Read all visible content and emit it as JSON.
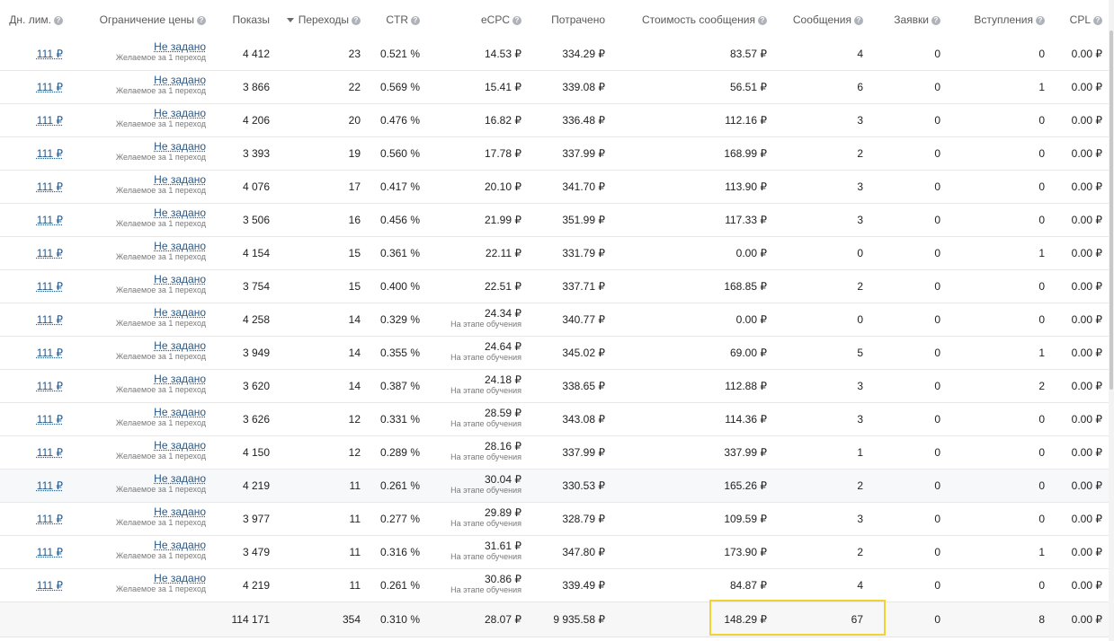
{
  "headers": {
    "daily_limit": "Дн. лим.",
    "price_limit": "Ограничение цены",
    "impressions": "Показы",
    "clicks": "Переходы",
    "ctr": "CTR",
    "ecpc": "eCPC",
    "spent": "Потрачено",
    "msg_cost": "Стоимость сообщения",
    "messages": "Сообщения",
    "applications": "Заявки",
    "joins": "Вступления",
    "cpl": "CPL"
  },
  "rows": [
    {
      "limit": "111 ₽",
      "price": "Не задано",
      "price_sub": "Желаемое за 1 переход",
      "impressions": "4 412",
      "clicks": "23",
      "ctr": "0.521 %",
      "ecpc": "14.53 ₽",
      "ecpc_sub": "",
      "spent": "334.29 ₽",
      "msg_cost": "83.57 ₽",
      "messages": "4",
      "applications": "0",
      "joins": "0",
      "cpl": "0.00 ₽"
    },
    {
      "limit": "111 ₽",
      "price": "Не задано",
      "price_sub": "Желаемое за 1 переход",
      "impressions": "3 866",
      "clicks": "22",
      "ctr": "0.569 %",
      "ecpc": "15.41 ₽",
      "ecpc_sub": "",
      "spent": "339.08 ₽",
      "msg_cost": "56.51 ₽",
      "messages": "6",
      "applications": "0",
      "joins": "1",
      "cpl": "0.00 ₽"
    },
    {
      "limit": "111 ₽",
      "price": "Не задано",
      "price_sub": "Желаемое за 1 переход",
      "impressions": "4 206",
      "clicks": "20",
      "ctr": "0.476 %",
      "ecpc": "16.82 ₽",
      "ecpc_sub": "",
      "spent": "336.48 ₽",
      "msg_cost": "112.16 ₽",
      "messages": "3",
      "applications": "0",
      "joins": "0",
      "cpl": "0.00 ₽"
    },
    {
      "limit": "111 ₽",
      "price": "Не задано",
      "price_sub": "Желаемое за 1 переход",
      "impressions": "3 393",
      "clicks": "19",
      "ctr": "0.560 %",
      "ecpc": "17.78 ₽",
      "ecpc_sub": "",
      "spent": "337.99 ₽",
      "msg_cost": "168.99 ₽",
      "messages": "2",
      "applications": "0",
      "joins": "0",
      "cpl": "0.00 ₽"
    },
    {
      "limit": "111 ₽",
      "price": "Не задано",
      "price_sub": "Желаемое за 1 переход",
      "impressions": "4 076",
      "clicks": "17",
      "ctr": "0.417 %",
      "ecpc": "20.10 ₽",
      "ecpc_sub": "",
      "spent": "341.70 ₽",
      "msg_cost": "113.90 ₽",
      "messages": "3",
      "applications": "0",
      "joins": "0",
      "cpl": "0.00 ₽"
    },
    {
      "limit": "111 ₽",
      "price": "Не задано",
      "price_sub": "Желаемое за 1 переход",
      "impressions": "3 506",
      "clicks": "16",
      "ctr": "0.456 %",
      "ecpc": "21.99 ₽",
      "ecpc_sub": "",
      "spent": "351.99 ₽",
      "msg_cost": "117.33 ₽",
      "messages": "3",
      "applications": "0",
      "joins": "0",
      "cpl": "0.00 ₽"
    },
    {
      "limit": "111 ₽",
      "price": "Не задано",
      "price_sub": "Желаемое за 1 переход",
      "impressions": "4 154",
      "clicks": "15",
      "ctr": "0.361 %",
      "ecpc": "22.11 ₽",
      "ecpc_sub": "",
      "spent": "331.79 ₽",
      "msg_cost": "0.00 ₽",
      "messages": "0",
      "applications": "0",
      "joins": "1",
      "cpl": "0.00 ₽"
    },
    {
      "limit": "111 ₽",
      "price": "Не задано",
      "price_sub": "Желаемое за 1 переход",
      "impressions": "3 754",
      "clicks": "15",
      "ctr": "0.400 %",
      "ecpc": "22.51 ₽",
      "ecpc_sub": "",
      "spent": "337.71 ₽",
      "msg_cost": "168.85 ₽",
      "messages": "2",
      "applications": "0",
      "joins": "0",
      "cpl": "0.00 ₽"
    },
    {
      "limit": "111 ₽",
      "price": "Не задано",
      "price_sub": "Желаемое за 1 переход",
      "impressions": "4 258",
      "clicks": "14",
      "ctr": "0.329 %",
      "ecpc": "24.34 ₽",
      "ecpc_sub": "На этапе обучения",
      "spent": "340.77 ₽",
      "msg_cost": "0.00 ₽",
      "messages": "0",
      "applications": "0",
      "joins": "0",
      "cpl": "0.00 ₽"
    },
    {
      "limit": "111 ₽",
      "price": "Не задано",
      "price_sub": "Желаемое за 1 переход",
      "impressions": "3 949",
      "clicks": "14",
      "ctr": "0.355 %",
      "ecpc": "24.64 ₽",
      "ecpc_sub": "На этапе обучения",
      "spent": "345.02 ₽",
      "msg_cost": "69.00 ₽",
      "messages": "5",
      "applications": "0",
      "joins": "1",
      "cpl": "0.00 ₽"
    },
    {
      "limit": "111 ₽",
      "price": "Не задано",
      "price_sub": "Желаемое за 1 переход",
      "impressions": "3 620",
      "clicks": "14",
      "ctr": "0.387 %",
      "ecpc": "24.18 ₽",
      "ecpc_sub": "На этапе обучения",
      "spent": "338.65 ₽",
      "msg_cost": "112.88 ₽",
      "messages": "3",
      "applications": "0",
      "joins": "2",
      "cpl": "0.00 ₽"
    },
    {
      "limit": "111 ₽",
      "price": "Не задано",
      "price_sub": "Желаемое за 1 переход",
      "impressions": "3 626",
      "clicks": "12",
      "ctr": "0.331 %",
      "ecpc": "28.59 ₽",
      "ecpc_sub": "На этапе обучения",
      "spent": "343.08 ₽",
      "msg_cost": "114.36 ₽",
      "messages": "3",
      "applications": "0",
      "joins": "0",
      "cpl": "0.00 ₽"
    },
    {
      "limit": "111 ₽",
      "price": "Не задано",
      "price_sub": "Желаемое за 1 переход",
      "impressions": "4 150",
      "clicks": "12",
      "ctr": "0.289 %",
      "ecpc": "28.16 ₽",
      "ecpc_sub": "На этапе обучения",
      "spent": "337.99 ₽",
      "msg_cost": "337.99 ₽",
      "messages": "1",
      "applications": "0",
      "joins": "0",
      "cpl": "0.00 ₽"
    },
    {
      "limit": "111 ₽",
      "price": "Не задано",
      "price_sub": "Желаемое за 1 переход",
      "impressions": "4 219",
      "clicks": "11",
      "ctr": "0.261 %",
      "ecpc": "30.04 ₽",
      "ecpc_sub": "На этапе обучения",
      "spent": "330.53 ₽",
      "msg_cost": "165.26 ₽",
      "messages": "2",
      "applications": "0",
      "joins": "0",
      "cpl": "0.00 ₽"
    },
    {
      "limit": "111 ₽",
      "price": "Не задано",
      "price_sub": "Желаемое за 1 переход",
      "impressions": "3 977",
      "clicks": "11",
      "ctr": "0.277 %",
      "ecpc": "29.89 ₽",
      "ecpc_sub": "На этапе обучения",
      "spent": "328.79 ₽",
      "msg_cost": "109.59 ₽",
      "messages": "3",
      "applications": "0",
      "joins": "0",
      "cpl": "0.00 ₽"
    },
    {
      "limit": "111 ₽",
      "price": "Не задано",
      "price_sub": "Желаемое за 1 переход",
      "impressions": "3 479",
      "clicks": "11",
      "ctr": "0.316 %",
      "ecpc": "31.61 ₽",
      "ecpc_sub": "На этапе обучения",
      "spent": "347.80 ₽",
      "msg_cost": "173.90 ₽",
      "messages": "2",
      "applications": "0",
      "joins": "1",
      "cpl": "0.00 ₽"
    },
    {
      "limit": "111 ₽",
      "price": "Не задано",
      "price_sub": "Желаемое за 1 переход",
      "impressions": "4 219",
      "clicks": "11",
      "ctr": "0.261 %",
      "ecpc": "30.86 ₽",
      "ecpc_sub": "На этапе обучения",
      "spent": "339.49 ₽",
      "msg_cost": "84.87 ₽",
      "messages": "4",
      "applications": "0",
      "joins": "0",
      "cpl": "0.00 ₽"
    }
  ],
  "totals": {
    "impressions": "114 171",
    "clicks": "354",
    "ctr": "0.310 %",
    "ecpc": "28.07 ₽",
    "spent": "9 935.58 ₽",
    "msg_cost": "148.29 ₽",
    "messages": "67",
    "applications": "0",
    "joins": "8",
    "cpl": "0.00 ₽"
  },
  "colors": {
    "link": "#2a5885",
    "highlight_border": "#f2d233",
    "hover_row": "#f7f8fa"
  },
  "icons": {
    "help": "question-circle-icon",
    "sort": "sort-desc-arrow-icon"
  },
  "sorted_column": "clicks",
  "hovered_row_index": 13
}
